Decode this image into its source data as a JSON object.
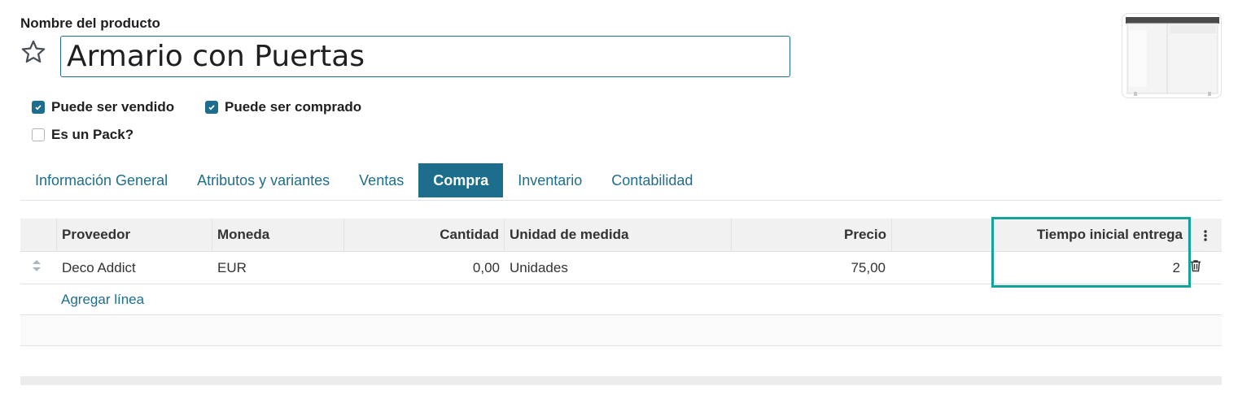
{
  "product": {
    "name_label": "Nombre del producto",
    "name_value": "Armario con Puertas",
    "image_icon": "cabinet-product-image"
  },
  "options": {
    "can_sell": {
      "label": "Puede ser vendido",
      "checked": true
    },
    "can_buy": {
      "label": "Puede ser comprado",
      "checked": true
    },
    "is_pack": {
      "label": "Es un Pack?",
      "checked": false
    }
  },
  "tabs": [
    {
      "label": "Información General",
      "active": false
    },
    {
      "label": "Atributos y variantes",
      "active": false
    },
    {
      "label": "Ventas",
      "active": false
    },
    {
      "label": "Compra",
      "active": true
    },
    {
      "label": "Inventario",
      "active": false
    },
    {
      "label": "Contabilidad",
      "active": false
    }
  ],
  "vendors": {
    "columns": {
      "proveedor": "Proveedor",
      "moneda": "Moneda",
      "cantidad": "Cantidad",
      "unidad": "Unidad de medida",
      "precio": "Precio",
      "tiempo": "Tiempo inicial entrega"
    },
    "rows": [
      {
        "proveedor": "Deco Addict",
        "moneda": "EUR",
        "cantidad": "0,00",
        "unidad": "Unidades",
        "precio": "75,00",
        "tiempo": "2"
      }
    ],
    "add_line": "Agregar línea"
  },
  "colors": {
    "accent": "#1d6e8c",
    "highlight": "#14a39a"
  }
}
